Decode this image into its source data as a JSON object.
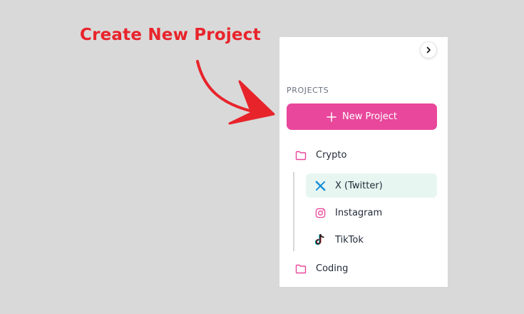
{
  "annotation": {
    "title": "Create New Project",
    "color": "#e8242b"
  },
  "sidebar": {
    "collapse_icon": "chevron-right-icon",
    "section_label": "PROJECTS",
    "new_project": {
      "label": "New Project",
      "icon": "plus-icon",
      "color": "#e8479b"
    },
    "folders": [
      {
        "label": "Crypto",
        "icon": "folder-icon",
        "items": [
          {
            "label": "X (Twitter)",
            "icon": "x-twitter-icon",
            "active": true
          },
          {
            "label": "Instagram",
            "icon": "instagram-icon",
            "active": false
          },
          {
            "label": "TikTok",
            "icon": "tiktok-icon",
            "active": false
          }
        ]
      },
      {
        "label": "Coding",
        "icon": "folder-icon",
        "items": []
      }
    ],
    "accent_folder_color": "#e8479b",
    "active_item_bg": "#e8f6f1"
  }
}
